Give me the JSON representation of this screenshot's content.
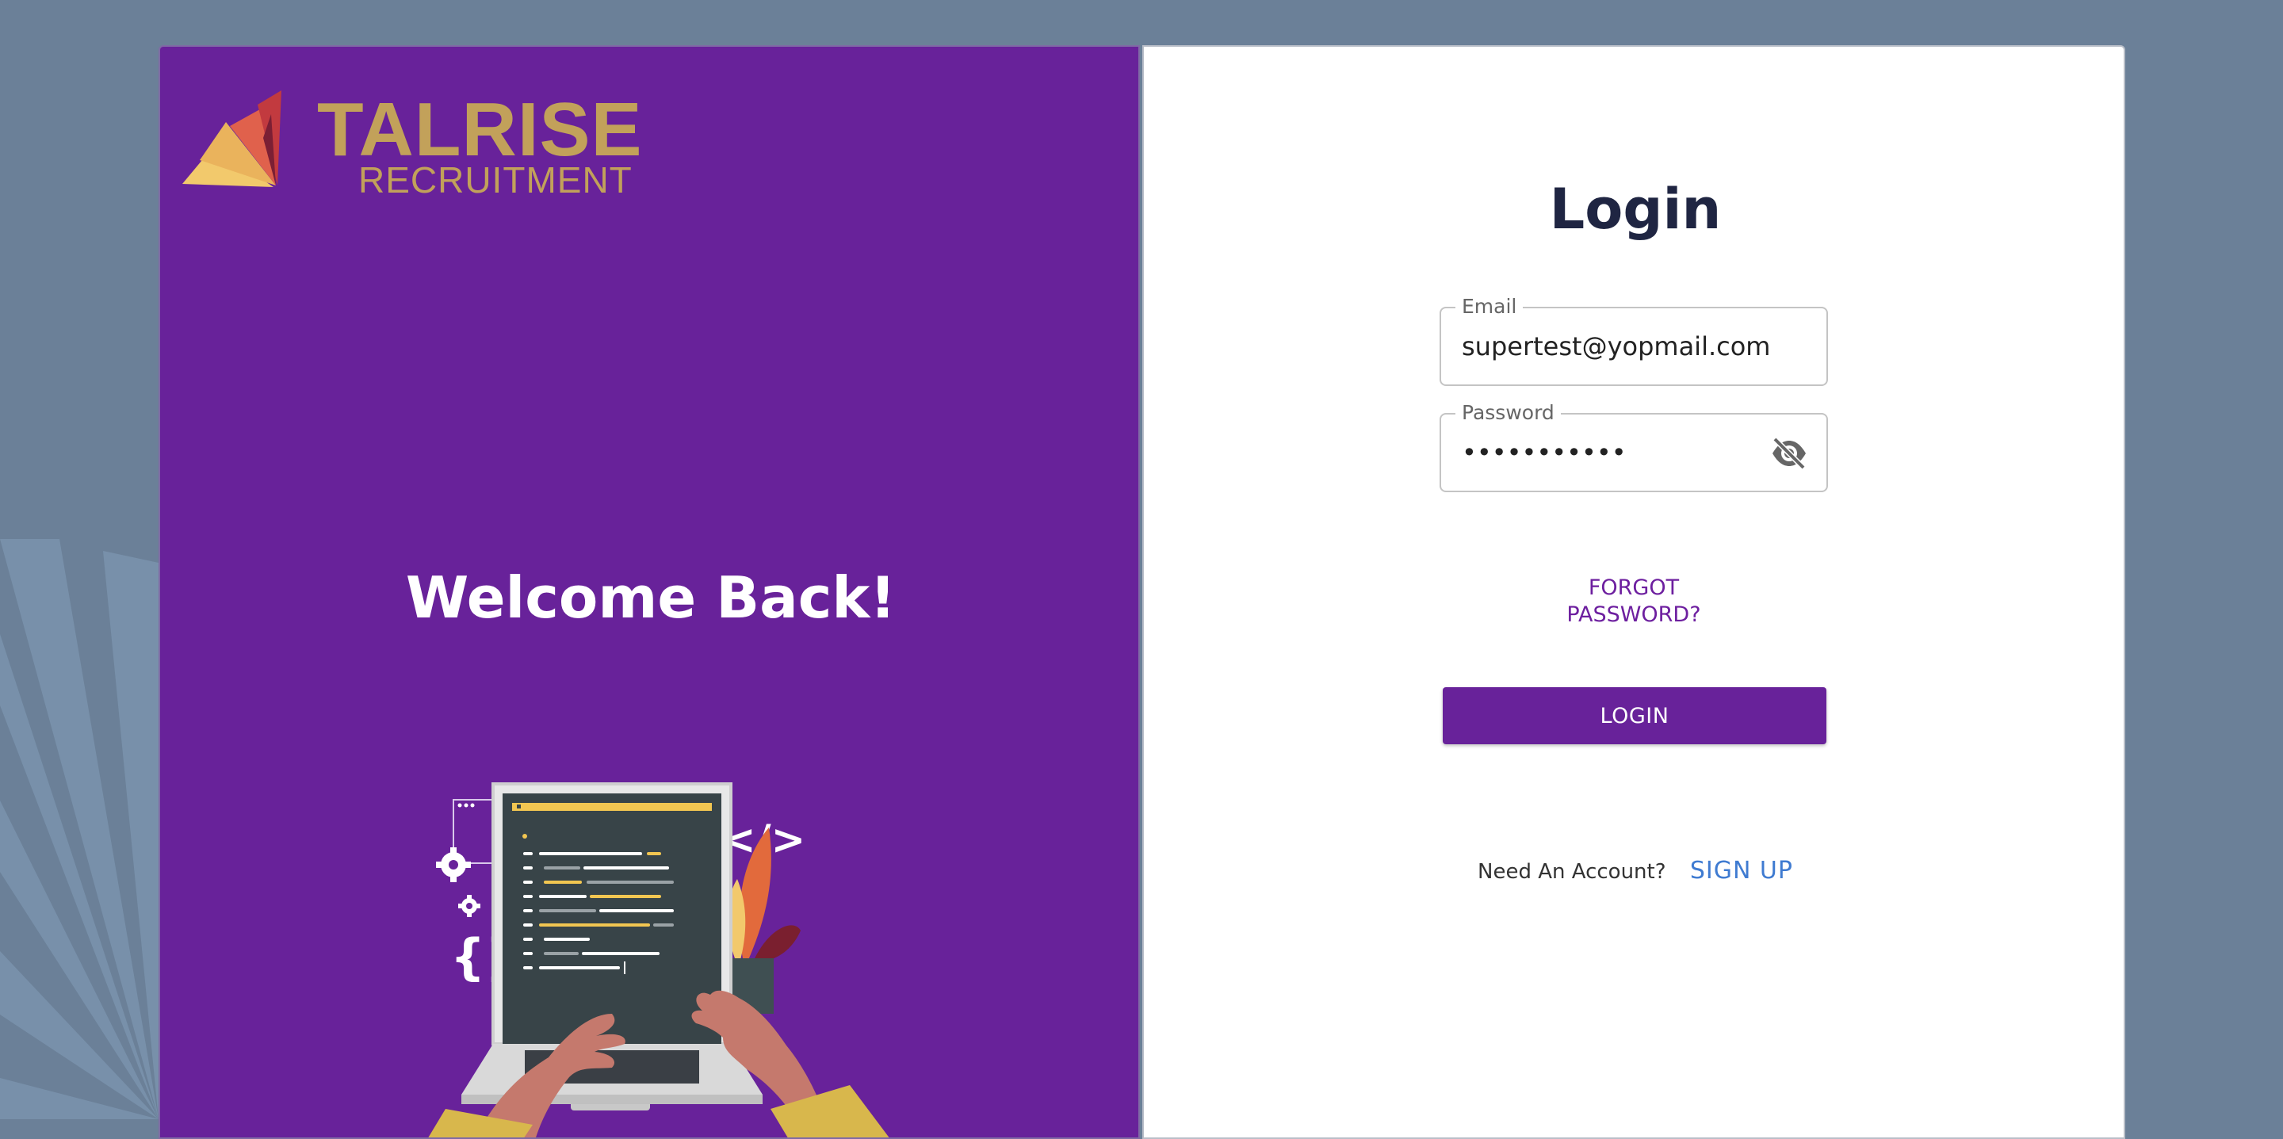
{
  "brand": {
    "name": "TALRISE",
    "subtitle": "RECRUITMENT",
    "gold": "#c2a15a",
    "purple": "#68229a"
  },
  "hero": {
    "welcome": "Welcome Back!",
    "illustration": "laptop-coding-illustration"
  },
  "login": {
    "title": "Login",
    "email": {
      "label": "Email",
      "value": "supertest@yopmail.com"
    },
    "password": {
      "label": "Password",
      "value": "•••••••••••",
      "toggle_icon": "eye-off-icon"
    },
    "forgot_line1": "FORGOT",
    "forgot_line2": "PASSWORD?",
    "submit_label": "LOGIN",
    "need_account": "Need An Account?",
    "signup_label": "SIGN UP"
  },
  "colors": {
    "page_bg": "#6b8098",
    "title_text": "#1f2542",
    "link_blue": "#3f7bd1"
  }
}
